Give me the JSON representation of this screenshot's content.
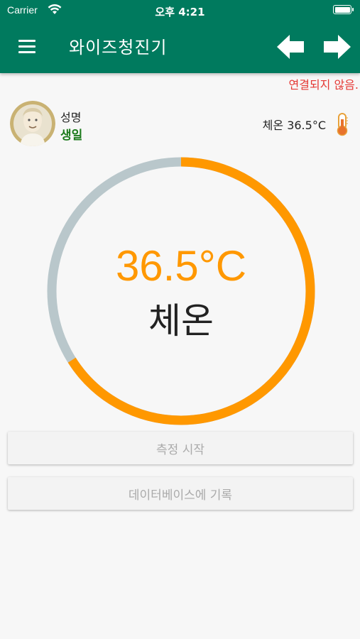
{
  "status_bar": {
    "carrier": "Carrier",
    "time": "오후 4:21"
  },
  "appbar": {
    "title": "와이즈청진기",
    "menu_icon": "hamburger-menu-icon",
    "prev_icon": "arrow-left-icon",
    "next_icon": "arrow-right-icon",
    "background_color": "#007a5e"
  },
  "connection_status": "연결되지 않음.",
  "profile": {
    "name": "성명",
    "birth": "생일"
  },
  "temperature_small": "체온 36.5°C",
  "gauge": {
    "value_text": "36.5°C",
    "caption": "체온",
    "fill_fraction": 0.66,
    "fill_color": "#ff9800",
    "track_color": "#b9c7cb"
  },
  "buttons": {
    "start": "측정 시작",
    "save": "데이터베이스에 기록"
  }
}
